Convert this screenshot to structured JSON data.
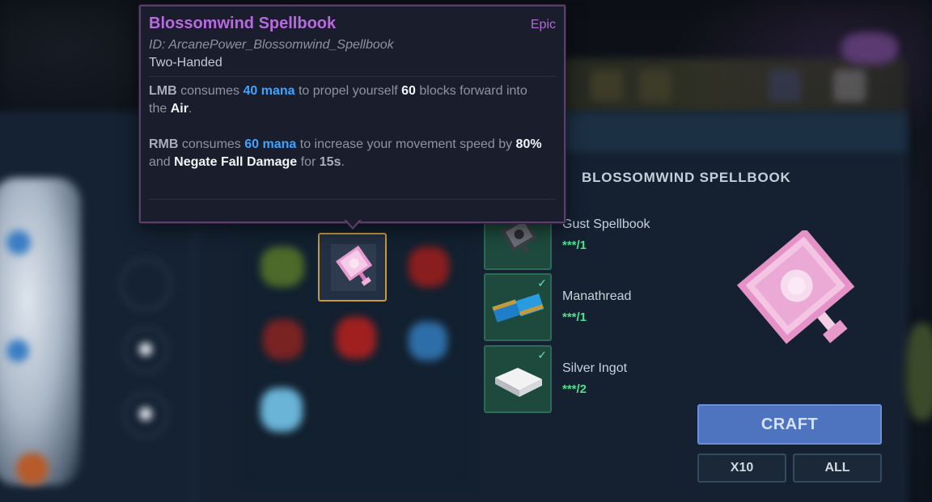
{
  "tooltip": {
    "title": "Blossomwind Spellbook",
    "rarity": "Epic",
    "id_line": "ID: ArcanePower_Blossomwind_Spellbook",
    "type": "Two-Handed",
    "lmb": {
      "key": "LMB",
      "t1": " consumes ",
      "mana": "40 mana",
      "t2": " to propel yourself ",
      "blocks": "60",
      "t3": " blocks forward into",
      "t4": "the ",
      "air": "Air",
      "t5": "."
    },
    "rmb": {
      "key": "RMB",
      "t1": " consumes ",
      "mana": "60 mana",
      "t2": " to increase your movement speed by ",
      "speed": "80%",
      "t3": "and ",
      "effect": "Negate Fall Damage",
      "t4": " for ",
      "duration": "15s",
      "t5": "."
    }
  },
  "recipe": {
    "title": "BLOSSOMWIND SPELLBOOK",
    "ingredients": [
      {
        "name": "Gust Spellbook",
        "qty": "***/1",
        "check": ""
      },
      {
        "name": "Manathread",
        "qty": "***/1",
        "check": "✓"
      },
      {
        "name": "Silver Ingot",
        "qty": "***/2",
        "check": "✓"
      }
    ]
  },
  "actions": {
    "craft": "CRAFT",
    "x10": "X10",
    "all": "ALL"
  },
  "colors": {
    "rarity_epic": "#b86be0",
    "mana": "#3fa3ff",
    "craft_button": "#4f74bf",
    "qty": "#4ee08e",
    "selected_border": "#c79a3a"
  }
}
